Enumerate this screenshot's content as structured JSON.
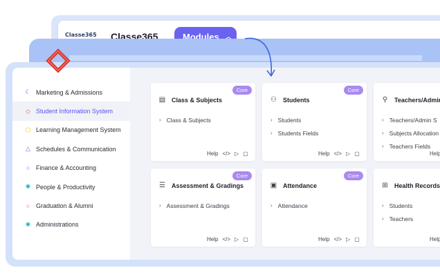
{
  "header": {
    "logo_text": "Classe365",
    "brand_name": "Classe365",
    "modules_button": "Modules",
    "modules_chevron": "^"
  },
  "sidebar": {
    "items": [
      {
        "label": "Marketing & Admissions",
        "icon": "moon-icon",
        "color": "#6b63f0"
      },
      {
        "label": "Student Information System",
        "icon": "diamond-icon",
        "color": "#e5533c"
      },
      {
        "label": "Learning Management System",
        "icon": "hexagon-icon",
        "color": "#f2c200"
      },
      {
        "label": "Schedules & Communication",
        "icon": "triangle-icon",
        "color": "#5b7be8"
      },
      {
        "label": "Finance & Accounting",
        "icon": "circle-icon",
        "color": "#6b63f0"
      },
      {
        "label": "People & Productivity",
        "icon": "gear-icon",
        "color": "#25b3c9"
      },
      {
        "label": "Graduation & Alumni",
        "icon": "ring-icon",
        "color": "#e5533c"
      },
      {
        "label": "Administrations",
        "icon": "cog-icon",
        "color": "#25b3c9"
      }
    ],
    "active_index": 1
  },
  "cards": [
    {
      "title": "Class & Subjects",
      "icon": "document-icon",
      "badge": "Core",
      "items": [
        "Class & Subjects"
      ]
    },
    {
      "title": "Students",
      "icon": "users-icon",
      "badge": "Core",
      "items": [
        "Students",
        "Students Fields"
      ]
    },
    {
      "title": "Teachers/Admin",
      "icon": "add-user-icon",
      "badge": "",
      "items": [
        "Teachers/Admin S",
        "Subjects Allocation",
        "Teachers Fields"
      ]
    },
    {
      "title": "Assessment & Gradings",
      "icon": "checklist-icon",
      "badge": "Core",
      "items": [
        "Assessment & Gradings"
      ]
    },
    {
      "title": "Attendance",
      "icon": "calendar-icon",
      "badge": "Core",
      "items": [
        "Attendance"
      ]
    },
    {
      "title": "Health Records",
      "icon": "medkit-icon",
      "badge": "",
      "items": [
        "Students",
        "Teachers"
      ]
    }
  ],
  "footer_labels": {
    "help": "Help",
    "code": "</>",
    "play": "▷",
    "chat": "▢"
  },
  "colors": {
    "accent": "#6b63f0",
    "badge": "#a88af0",
    "frame": "#d4e1fb",
    "arrow": "#3a64d8"
  }
}
